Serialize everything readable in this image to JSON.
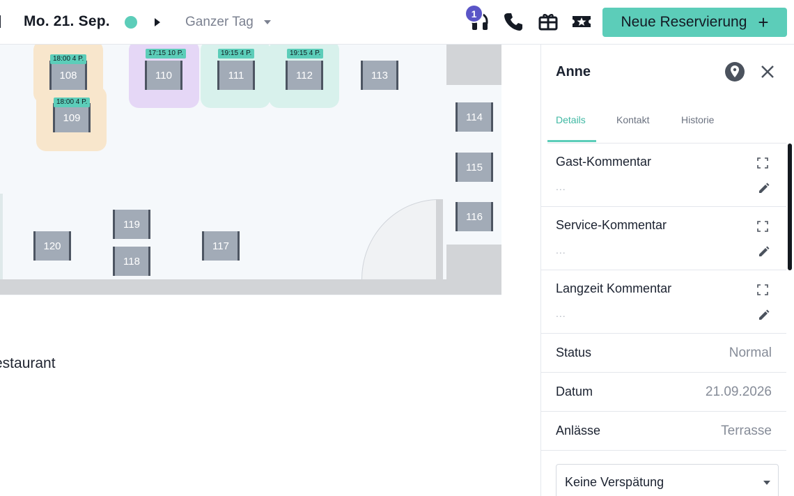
{
  "header": {
    "date": "Mo. 21. Sep.",
    "period": "Ganzer Tag",
    "notification_count": "1",
    "new_reservation_label": "Neue Reservierung",
    "new_reservation_plus": "+",
    "icons": [
      "headset-icon",
      "phone-icon",
      "gift-card-icon",
      "ticket-star-icon"
    ]
  },
  "floor": {
    "room_label": "estaurant",
    "tables": [
      {
        "number": "108",
        "tag": "18:00 4 P."
      },
      {
        "number": "109",
        "tag": "18:00 4 P."
      },
      {
        "number": "110",
        "tag": "17:15 10 P."
      },
      {
        "number": "111",
        "tag": "19:15 4 P."
      },
      {
        "number": "112",
        "tag": "19:15 4 P."
      },
      {
        "number": "113"
      },
      {
        "number": "114"
      },
      {
        "number": "115"
      },
      {
        "number": "116"
      },
      {
        "number": "117"
      },
      {
        "number": "118"
      },
      {
        "number": "119"
      },
      {
        "number": "120"
      }
    ]
  },
  "panel": {
    "guest_name": "Anne",
    "tabs": [
      {
        "label": "Details",
        "active": true
      },
      {
        "label": "Kontakt"
      },
      {
        "label": "Historie"
      }
    ],
    "comments": [
      {
        "title": "Gast-Kommentar",
        "value": "..."
      },
      {
        "title": "Service-Kommentar",
        "value": "..."
      },
      {
        "title": "Langzeit Kommentar",
        "value": "..."
      }
    ],
    "info": [
      {
        "key": "Status",
        "value": "Normal"
      },
      {
        "key": "Datum",
        "value": "21.09.2026"
      },
      {
        "key": "Anlässe",
        "value": "Terrasse"
      }
    ],
    "delay_select": "Keine Verspätung"
  },
  "colors": {
    "accent": "#5ccdb9",
    "badge": "#5a55c7",
    "table": "#a2abb7",
    "zone_peach": "#f8e6cc",
    "zone_violet": "#e5d7f6",
    "zone_mint": "#d8f1ec"
  }
}
